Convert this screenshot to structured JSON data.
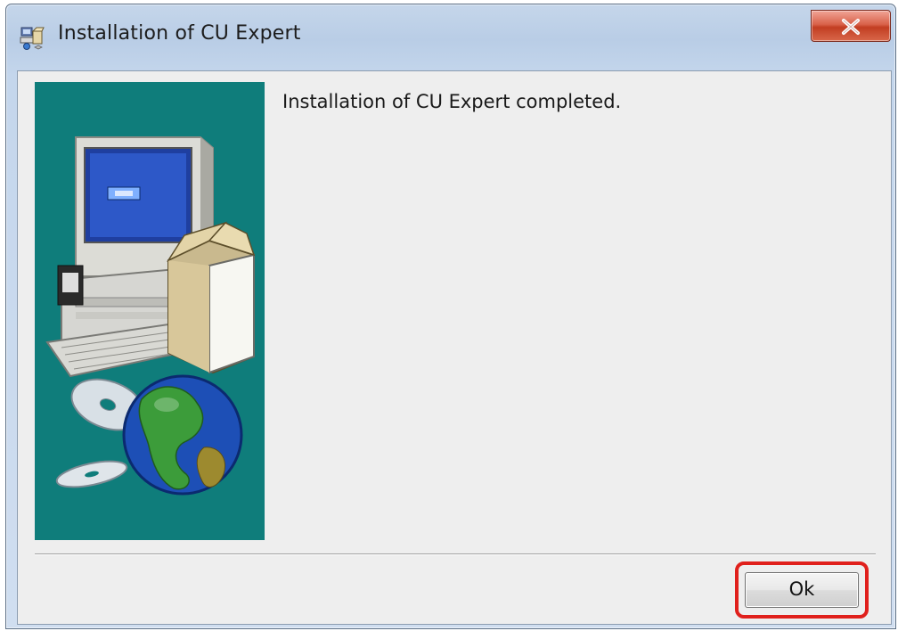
{
  "window": {
    "title": "Installation of CU Expert",
    "icon": "installer-icon",
    "close_icon": "close-icon"
  },
  "dialog": {
    "message": "Installation of CU Expert completed.",
    "banner_image": "computer-globe-illustration",
    "banner_color": "#0f7d7b"
  },
  "buttons": {
    "ok_label": "Ok"
  },
  "highlight": {
    "color": "#e0201c",
    "target": "ok-button"
  }
}
